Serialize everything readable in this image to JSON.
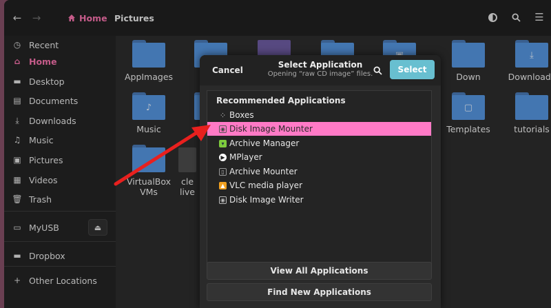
{
  "headerbar": {
    "home_label": "Home",
    "path_label": "Pictures"
  },
  "sidebar": {
    "items": [
      {
        "label": "Recent",
        "icon": "clock-icon"
      },
      {
        "label": "Home",
        "icon": "home-icon",
        "active": true
      },
      {
        "label": "Desktop",
        "icon": "desktop-icon"
      },
      {
        "label": "Documents",
        "icon": "documents-icon"
      },
      {
        "label": "Downloads",
        "icon": "download-icon"
      },
      {
        "label": "Music",
        "icon": "music-icon"
      },
      {
        "label": "Pictures",
        "icon": "pictures-icon"
      },
      {
        "label": "Videos",
        "icon": "video-icon"
      },
      {
        "label": "Trash",
        "icon": "trash-icon"
      },
      {
        "label": "MyUSB",
        "icon": "usb-drive-icon"
      },
      {
        "label": "Dropbox",
        "icon": "folder-icon"
      },
      {
        "label": "Other Locations",
        "icon": "plus-icon"
      }
    ]
  },
  "files": [
    {
      "label": "AppImages",
      "icon": "folder-icon"
    },
    {
      "label": "Down",
      "icon": "folder-icon"
    },
    {
      "label": "Downloads",
      "icon": "download-folder-icon"
    },
    {
      "label": "Music",
      "icon": "music-folder-icon"
    },
    {
      "label": "Templates",
      "icon": "templates-folder-icon"
    },
    {
      "label": "tutorials",
      "icon": "folder-icon"
    },
    {
      "label": "VirtualBox\nVMs",
      "icon": "folder-icon"
    },
    {
      "label": "cle",
      "icon": "file-icon"
    },
    {
      "label": "live",
      "icon": "file-icon"
    }
  ],
  "dialog": {
    "cancel_label": "Cancel",
    "title": "Select Application",
    "subtitle": "Opening “raw CD image” files.",
    "select_label": "Select",
    "section_heading": "Recommended Applications",
    "apps": [
      {
        "label": "Boxes",
        "icon": "boxes-icon",
        "color": "#bbbbbb"
      },
      {
        "label": "Disk Image Mounter",
        "icon": "disk-image-icon",
        "color": "#dddddd",
        "selected": true
      },
      {
        "label": "Archive Manager",
        "icon": "archive-icon",
        "color": "#7ecb3d"
      },
      {
        "label": "MPlayer",
        "icon": "mplayer-icon",
        "color": "#ffffff"
      },
      {
        "label": "Archive Mounter",
        "icon": "archive-mount-icon",
        "color": "#999999"
      },
      {
        "label": "VLC media player",
        "icon": "vlc-icon",
        "color": "#f0a020"
      },
      {
        "label": "Disk Image Writer",
        "icon": "disk-writer-icon",
        "color": "#bbbbbb"
      }
    ],
    "view_all_label": "View All Applications",
    "find_new_label": "Find New Applications"
  },
  "colors": {
    "accent": "#f070a8",
    "selection": "#ff7ac6",
    "select_button": "#68bfd0",
    "folder": "#5290d8",
    "annotation_arrow": "#e8201e"
  }
}
